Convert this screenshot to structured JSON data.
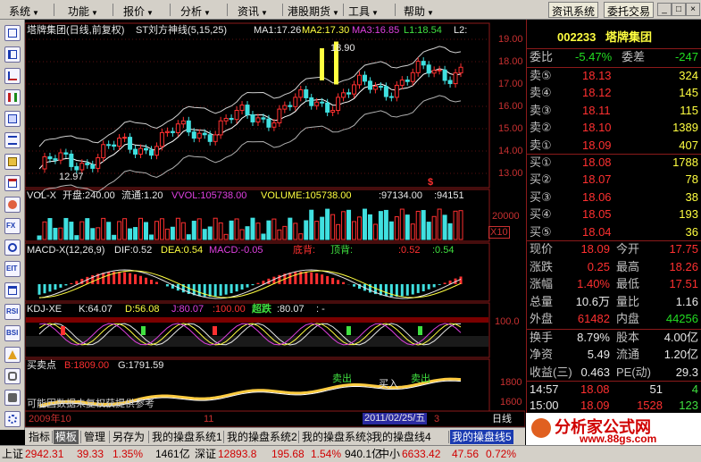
{
  "menu": {
    "items": [
      "系统",
      "功能",
      "报价",
      "分析",
      "资讯",
      "港股期货",
      "工具",
      "帮助"
    ],
    "buttons": [
      "资讯系统",
      "委托交易"
    ],
    "window": [
      "_",
      "□",
      "×"
    ]
  },
  "chart": {
    "title": "塔牌集团(日线,前复权)",
    "indicator": "ST刘方神线(5,15,25)",
    "ma1": "MA1:17.26",
    "ma2": "MA2:17.30",
    "ma3": "MA3:16.85",
    "ma4": "L1:18.54",
    "ma5": "L2:",
    "high_label": "18.90",
    "low_label": "12.97",
    "price_axis": [
      "19.00",
      "18.00",
      "17.00",
      "16.00",
      "15.00",
      "14.00",
      "13.00"
    ],
    "marker_dollar": "$",
    "vol": {
      "name": "VOL-X",
      "open": "开盘:240.00",
      "circ": "流通:1.20",
      "vvol": "VVOL:105738.00",
      "volume": "VOLUME:105738.00",
      "v1": ":97134.00",
      "v2": ":94151",
      "axis": "20000",
      "scale": "X10"
    },
    "macd": {
      "name": "MACD-X(12,26,9)",
      "dif": "DIF:0.52",
      "dea": "DEA:0.54",
      "macd": "MACD:-0.05",
      "top": "底背:",
      "bottom": "顶背:",
      "v1": ":0.52",
      "v2": ":0.54"
    },
    "kdj": {
      "name": "KDJ-XE",
      "k": "K:64.07",
      "d": "D:56.08",
      "j": "J:80.07",
      "v1": ":100.00",
      "cross": "超跌",
      "v2": ":80.07",
      "v3": ": -",
      "axis": "100.0"
    },
    "bs": {
      "name": "买卖点",
      "b": "B:1809.00",
      "g": "G:1791.59",
      "axis": [
        "1800",
        "1600"
      ],
      "sell1": "卖出",
      "buy": "买入",
      "sell2": "卖出",
      "note": "可能因数据未复权获提供参考"
    },
    "dates": {
      "left": "2009年10",
      "mid": "11",
      "cursor": "2011/02/25/五",
      "right": "3",
      "period": "日线"
    }
  },
  "quote": {
    "code": "002233",
    "name": "塔牌集团",
    "ratio_label": "委比",
    "ratio": "-5.47%",
    "diff_label": "委差",
    "diff": "-247",
    "sells": [
      {
        "label": "卖⑤",
        "price": "18.13",
        "vol": "324"
      },
      {
        "label": "卖④",
        "price": "18.12",
        "vol": "145"
      },
      {
        "label": "卖③",
        "price": "18.11",
        "vol": "115"
      },
      {
        "label": "卖②",
        "price": "18.10",
        "vol": "1389"
      },
      {
        "label": "卖①",
        "price": "18.09",
        "vol": "407"
      }
    ],
    "buys": [
      {
        "label": "买①",
        "price": "18.08",
        "vol": "1788"
      },
      {
        "label": "买②",
        "price": "18.07",
        "vol": "78"
      },
      {
        "label": "买③",
        "price": "18.06",
        "vol": "38"
      },
      {
        "label": "买④",
        "price": "18.05",
        "vol": "193"
      },
      {
        "label": "买⑤",
        "price": "18.04",
        "vol": "36"
      }
    ],
    "stats": [
      {
        "l1": "现价",
        "v1": "18.09",
        "l2": "今开",
        "v2": "17.75",
        "c1": "#ff3030",
        "c2": "#ff3030"
      },
      {
        "l1": "涨跌",
        "v1": "0.25",
        "l2": "最高",
        "v2": "18.26",
        "c1": "#ff3030",
        "c2": "#ff3030"
      },
      {
        "l1": "涨幅",
        "v1": "1.40%",
        "l2": "最低",
        "v2": "17.51",
        "c1": "#ff3030",
        "c2": "#ff3030"
      },
      {
        "l1": "总量",
        "v1": "10.6万",
        "l2": "量比",
        "v2": "1.16",
        "c1": "#e8e8e8",
        "c2": "#e8e8e8"
      },
      {
        "l1": "外盘",
        "v1": "61482",
        "l2": "内盘",
        "v2": "44256",
        "c1": "#ff3030",
        "c2": "#22dd22"
      }
    ],
    "stats2": [
      {
        "l1": "换手",
        "v1": "8.79%",
        "l2": "股本",
        "v2": "4.00亿"
      },
      {
        "l1": "净资",
        "v1": "5.49",
        "l2": "流通",
        "v2": "1.20亿"
      },
      {
        "l1": "收益(三)",
        "v1": "0.463",
        "l2": "PE(动)",
        "v2": "29.3"
      }
    ],
    "ticks": [
      {
        "time": "14:57",
        "price": "18.08",
        "vol": "51",
        "num": "4"
      },
      {
        "time": "15:00",
        "price": "18.09",
        "vol": "1528",
        "num": "123"
      }
    ]
  },
  "tabs": [
    "指标",
    "模板",
    "管理",
    "另存为",
    "我的操盘系统1",
    "我的操盘系统2",
    "我的操盘系统3",
    "我的操盘线4",
    "我的操盘线5"
  ],
  "status": {
    "sh_label": "上证",
    "sh": "2942.31",
    "sh_chg": "39.33",
    "sh_pct": "1.35%",
    "sh_amt": "1461亿",
    "sz_label": "深证",
    "sz": "12893.8",
    "sz_chg": "195.68",
    "sz_pct": "1.54%",
    "sz_amt": "940.1亿",
    "mid_label": "中小",
    "mid": "6633.42",
    "mid_chg": "47.56",
    "mid_pct": "0.72%"
  },
  "brand": {
    "name": "分析家公式网",
    "url": "www.88gs.com"
  },
  "colors": {
    "up": "#ff3030",
    "down": "#22dd22",
    "grid": "#8b1a1a",
    "yellow": "#ffff40",
    "cyan": "#40e0e0",
    "magenta": "#e040e0"
  }
}
